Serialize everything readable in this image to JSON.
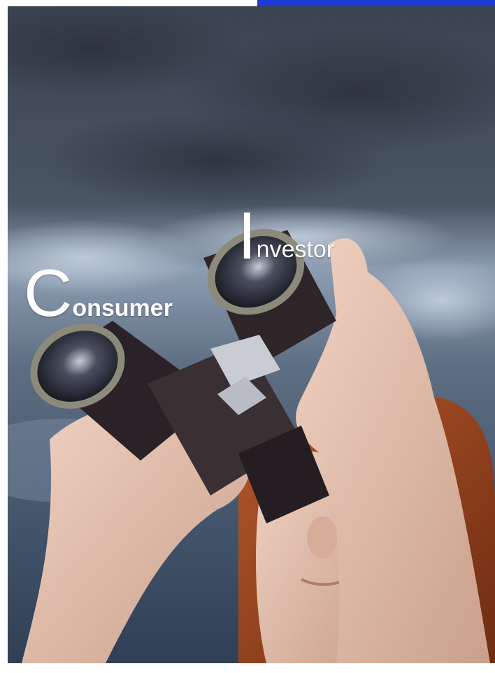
{
  "headline": {
    "word1_initial": "C",
    "word1_rest": "onsumer",
    "word2_initial": "I",
    "word2_rest": "nvestor"
  },
  "colors": {
    "accent_bar": "#1d39d6",
    "sky_dark": "#3a4452",
    "sky_light": "#9fb0c4",
    "text": "#ffffff"
  },
  "photo": {
    "subject": "person-with-binoculars-icon"
  }
}
